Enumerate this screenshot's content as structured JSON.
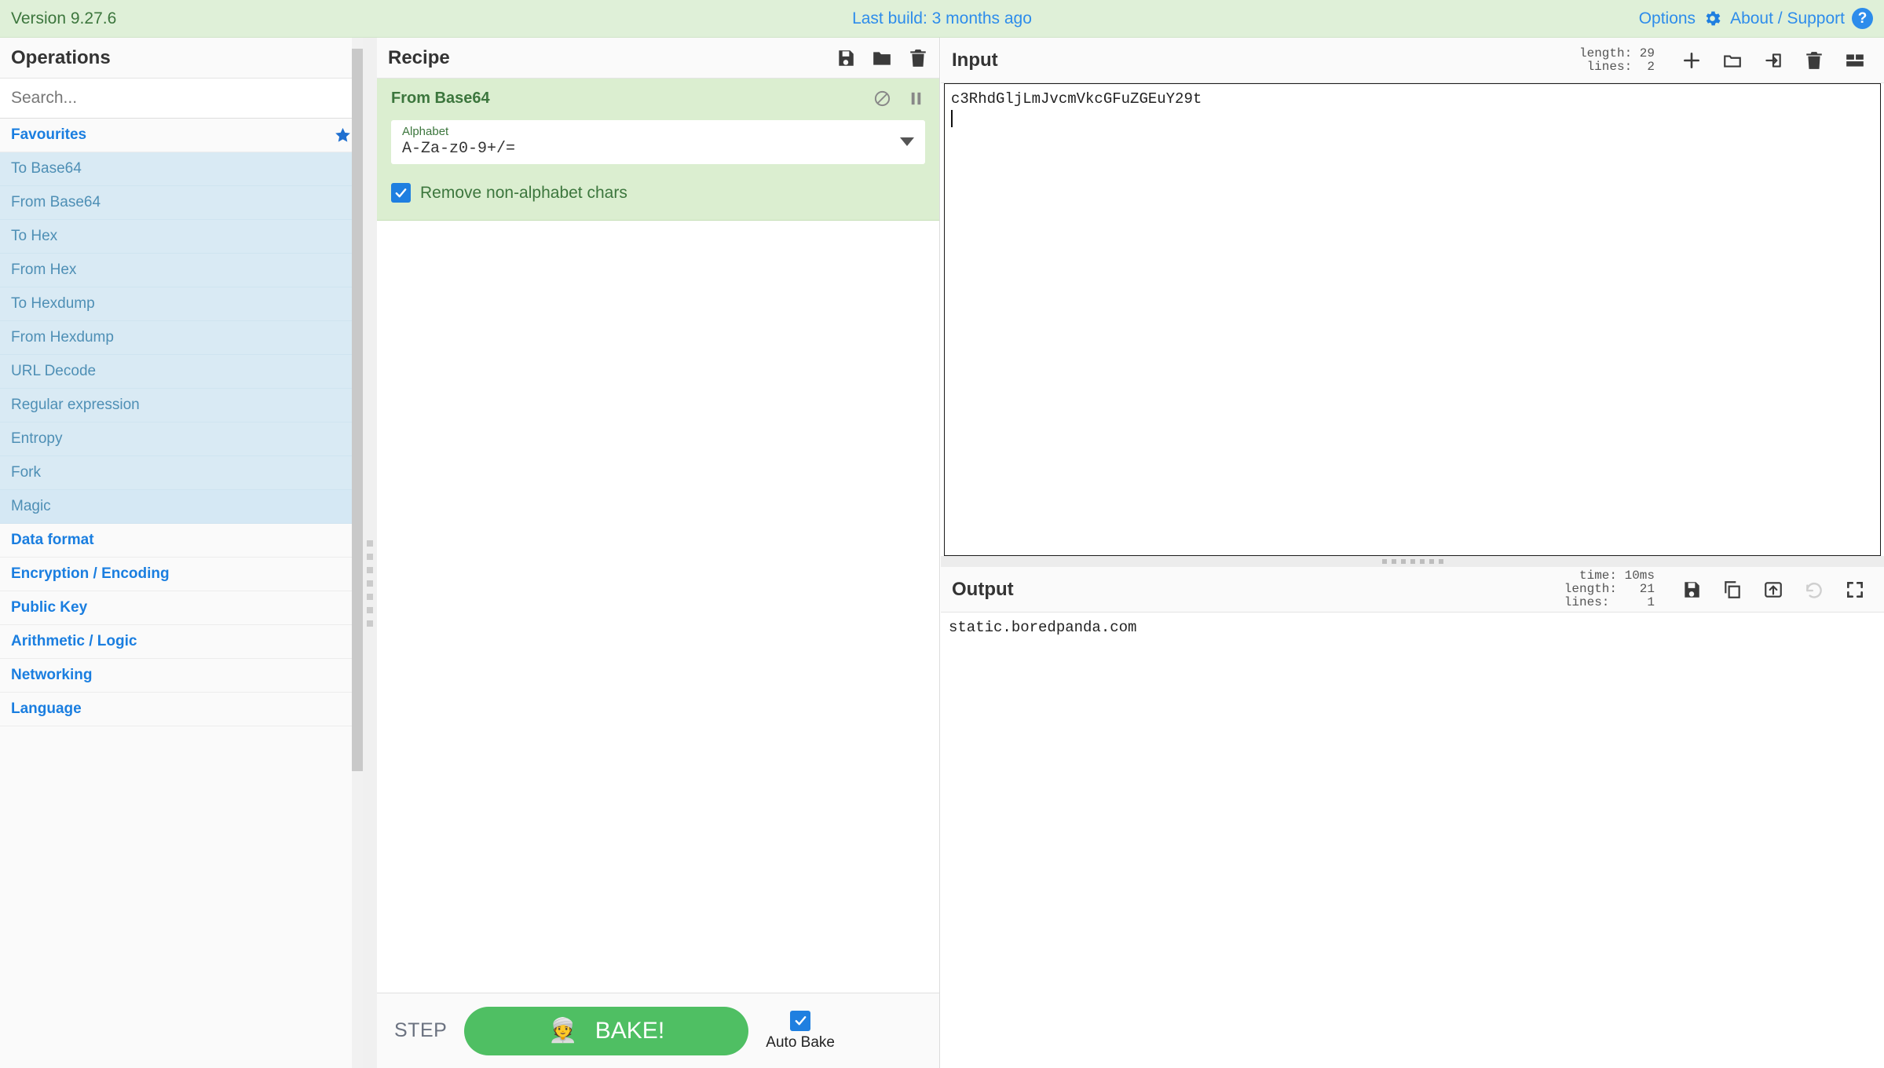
{
  "banner": {
    "version": "Version 9.27.6",
    "last_build": "Last build: 3 months ago",
    "options_label": "Options",
    "about_label": "About / Support",
    "help_glyph": "?",
    "bg_color": "#dff0d8",
    "link_color": "#2d8ceb",
    "version_color": "#3c763d"
  },
  "operations": {
    "title": "Operations",
    "search_placeholder": "Search...",
    "search_value": "",
    "favourites_label": "Favourites",
    "favourites": [
      "To Base64",
      "From Base64",
      "To Hex",
      "From Hex",
      "To Hexdump",
      "From Hexdump",
      "URL Decode",
      "Regular expression",
      "Entropy",
      "Fork",
      "Magic"
    ],
    "categories": [
      "Data format",
      "Encryption / Encoding",
      "Public Key",
      "Arithmetic / Logic",
      "Networking",
      "Language"
    ]
  },
  "recipe": {
    "title": "Recipe",
    "icons": {
      "save": "save-icon",
      "load": "folder-icon",
      "clear": "trash-icon"
    },
    "operation": {
      "name": "From Base64",
      "disable_icon": "disable-icon",
      "breakpoint_icon": "pause-icon",
      "arg_label": "Alphabet",
      "arg_value": "A-Za-z0-9+/=",
      "checkbox_label": "Remove non-alphabet chars",
      "checkbox_checked": true,
      "bg_color": "#dbeed0",
      "title_color": "#3c763d"
    },
    "controls": {
      "step_label": "STEP",
      "bake_label": "BAKE!",
      "bake_icon": "chef-icon",
      "auto_bake_label": "Auto Bake",
      "auto_bake_checked": true,
      "bake_color": "#4fbf63"
    }
  },
  "input": {
    "title": "Input",
    "stats": "length: 29\nlines:  2",
    "length": 29,
    "lines": 2,
    "value": "c3RhdGljLmJvcmVkcGFuZGEuY29t",
    "icons": {
      "add_tab": "plus-icon",
      "open_folder": "folder-icon",
      "open_file": "import-icon",
      "clear": "trash-icon",
      "tabs": "layout-icon"
    }
  },
  "output": {
    "title": "Output",
    "stats": "time: 10ms\nlength:   21\nlines:     1",
    "time": "10ms",
    "length": 21,
    "lines": 1,
    "value": "static.boredpanda.com",
    "icons": {
      "save": "save-icon",
      "copy": "copy-icon",
      "replace_input": "move-to-input-icon",
      "undo": "undo-icon",
      "maximise": "maximise-icon"
    }
  }
}
